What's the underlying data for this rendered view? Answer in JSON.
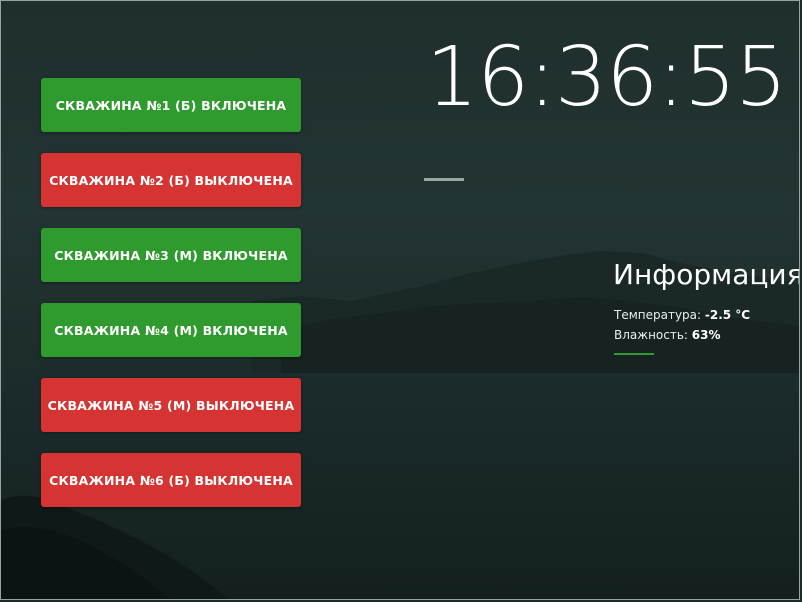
{
  "wells": [
    {
      "label": "СКВАЖИНА №1 (Б) ВКЛЮЧЕНА",
      "status": "on"
    },
    {
      "label": "СКВАЖИНА №2 (Б) ВЫКЛЮЧЕНА",
      "status": "off"
    },
    {
      "label": "СКВАЖИНА №3 (М) ВКЛЮЧЕНА",
      "status": "on"
    },
    {
      "label": "СКВАЖИНА №4 (М) ВКЛЮЧЕНА",
      "status": "on"
    },
    {
      "label": "СКВАЖИНА №5 (М) ВЫКЛЮЧЕНА",
      "status": "off"
    },
    {
      "label": "СКВАЖИНА №6 (Б) ВЫКЛЮЧЕНА",
      "status": "off"
    }
  ],
  "clock": {
    "time": "16:36:55"
  },
  "info": {
    "title": "Информация",
    "temperature_label": "Температура: ",
    "temperature_value": "-2.5 °C",
    "humidity_label": "Влажность: ",
    "humidity_value": "63%"
  },
  "colors": {
    "on": "#2f9a2d",
    "off": "#d53433",
    "accent": "#2f9a2d"
  }
}
